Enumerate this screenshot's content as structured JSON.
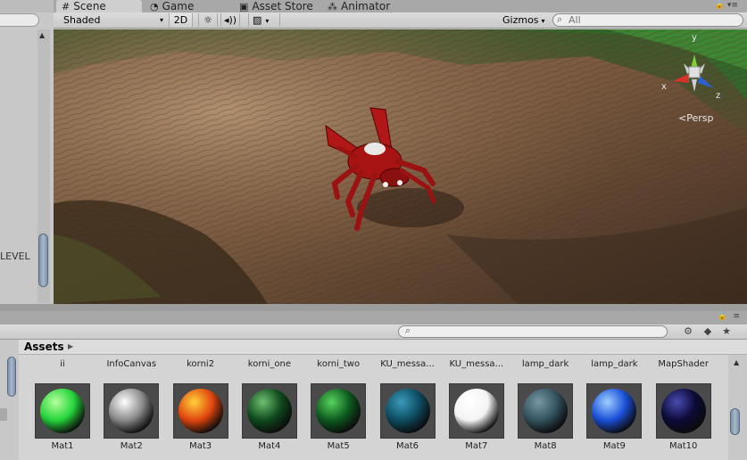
{
  "hierarchy": {
    "scene_label": "LEVEL"
  },
  "tabs": [
    {
      "label": "Scene",
      "icon": "grid-icon"
    },
    {
      "label": "Game",
      "icon": "pacman-icon"
    },
    {
      "label": "Asset Store",
      "icon": "bag-icon"
    },
    {
      "label": "Animator",
      "icon": "animator-icon"
    }
  ],
  "scene_toolbar": {
    "shading_mode": "Shaded",
    "mode_2d": "2D",
    "gizmos": "Gizmos",
    "search_placeholder": "All"
  },
  "viewport": {
    "projection": "Persp",
    "axis_labels": {
      "x": "x",
      "y": "y",
      "z": "z"
    },
    "colors": {
      "x_axis": "#d8332a",
      "y_axis": "#7fd03a",
      "z_axis": "#2c5fd6"
    }
  },
  "project": {
    "breadcrumb": "Assets",
    "top_row_names": [
      "ii",
      "InfoCanvas",
      "korni2",
      "korni_one",
      "korni_two",
      "KU_messa...",
      "KU_messa...",
      "lamp_dark",
      "lamp_dark",
      "MapShader"
    ],
    "materials": [
      {
        "name": "Mat1",
        "color": "#25d43a",
        "highlight": "#b6ff9c"
      },
      {
        "name": "Mat2",
        "color": "#8a8a8a",
        "highlight": "#ffffff"
      },
      {
        "name": "Mat3",
        "color": "#e2460e",
        "highlight": "#ffd23a"
      },
      {
        "name": "Mat4",
        "color": "#0f4a1d",
        "highlight": "#6fbf72"
      },
      {
        "name": "Mat5",
        "color": "#0d5a1e",
        "highlight": "#58d35e"
      },
      {
        "name": "Mat6",
        "color": "#0d4d62",
        "highlight": "#3a9ab8"
      },
      {
        "name": "Mat7",
        "color": "#f4f4f4",
        "highlight": "#ffffff"
      },
      {
        "name": "Mat8",
        "color": "#33535f",
        "highlight": "#7898a5"
      },
      {
        "name": "Mat9",
        "color": "#1a4fd8",
        "highlight": "#9fd0ff"
      },
      {
        "name": "Mat10",
        "color": "#0b0b38",
        "highlight": "#4a4ab0"
      }
    ]
  }
}
